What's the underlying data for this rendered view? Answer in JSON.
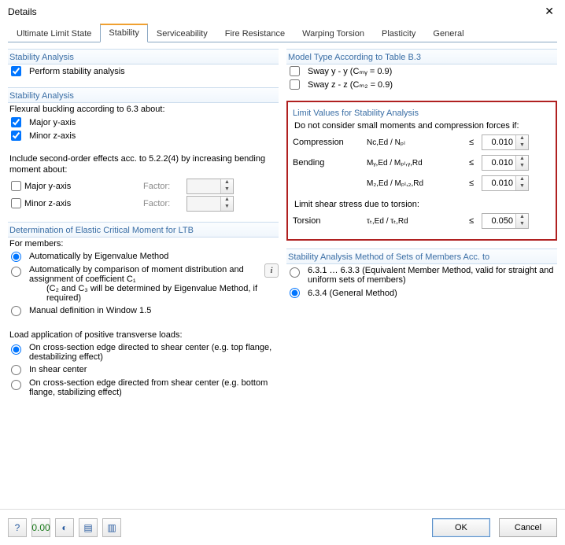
{
  "window": {
    "title": "Details"
  },
  "tabs": {
    "t0": "Ultimate Limit State",
    "t1": "Stability",
    "t2": "Serviceability",
    "t3": "Fire Resistance",
    "t4": "Warping Torsion",
    "t5": "Plasticity",
    "t6": "General"
  },
  "left": {
    "stab_head": "Stability Analysis",
    "perform": "Perform stability analysis",
    "sa2_head": "Stability Analysis",
    "flex_intro": "Flexural buckling according to 6.3 about:",
    "major_y": "Major y-axis",
    "minor_z": "Minor z-axis",
    "second_order": "Include second-order effects acc. to 5.2.2(4) by increasing bending moment about:",
    "factor": "Factor:",
    "elastic_head": "Determination of Elastic Critical Moment for LTB",
    "for_members": "For members:",
    "auto_eig": "Automatically by Eigenvalue Method",
    "auto_cmp": "Automatically by comparison of moment distribution and assignment of coefficient C₁",
    "auto_cmp_note": "(C₂ and C₃ will be determined by Eigenvalue Method, if required)",
    "manual": "Manual definition in Window 1.5",
    "load_app": "Load application of positive transverse loads:",
    "la1": "On cross-section edge directed to shear center (e.g. top flange, destabilizing effect)",
    "la2": "In shear center",
    "la3": "On cross-section edge directed from shear center (e.g. bottom flange, stabilizing effect)"
  },
  "right": {
    "model_head": "Model Type According to Table B.3",
    "sway_y": "Sway y - y (Cₘᵧ = 0.9)",
    "sway_z": "Sway z - z (Cₘ₂ = 0.9)",
    "limit_head": "Limit Values for Stability Analysis",
    "limit_intro": "Do not consider small moments and compression forces if:",
    "compression": "Compression",
    "comp_formula": "Nᴄ,Ed / Nₚₗ",
    "bending": "Bending",
    "bend_y_formula": "Mᵧ,Ed / Mₚₗ,ᵧ,Rd",
    "bend_z_formula": "M₂,Ed / Mₚₗ,₂,Rd",
    "shear_note": "Limit shear stress due to torsion:",
    "torsion": "Torsion",
    "tor_formula": "τₜ,Ed / τₜ,Rd",
    "le": "≤",
    "v_comp": "0.010",
    "v_bendy": "0.010",
    "v_bendz": "0.010",
    "v_tor": "0.050",
    "method_head": "Stability Analysis Method of Sets of Members Acc. to",
    "m1": "6.3.1 … 6.3.3 (Equivalent Member Method, valid for straight and uniform sets of members)",
    "m2": "6.3.4  (General Method)"
  },
  "footer": {
    "ok": "OK",
    "cancel": "Cancel"
  }
}
